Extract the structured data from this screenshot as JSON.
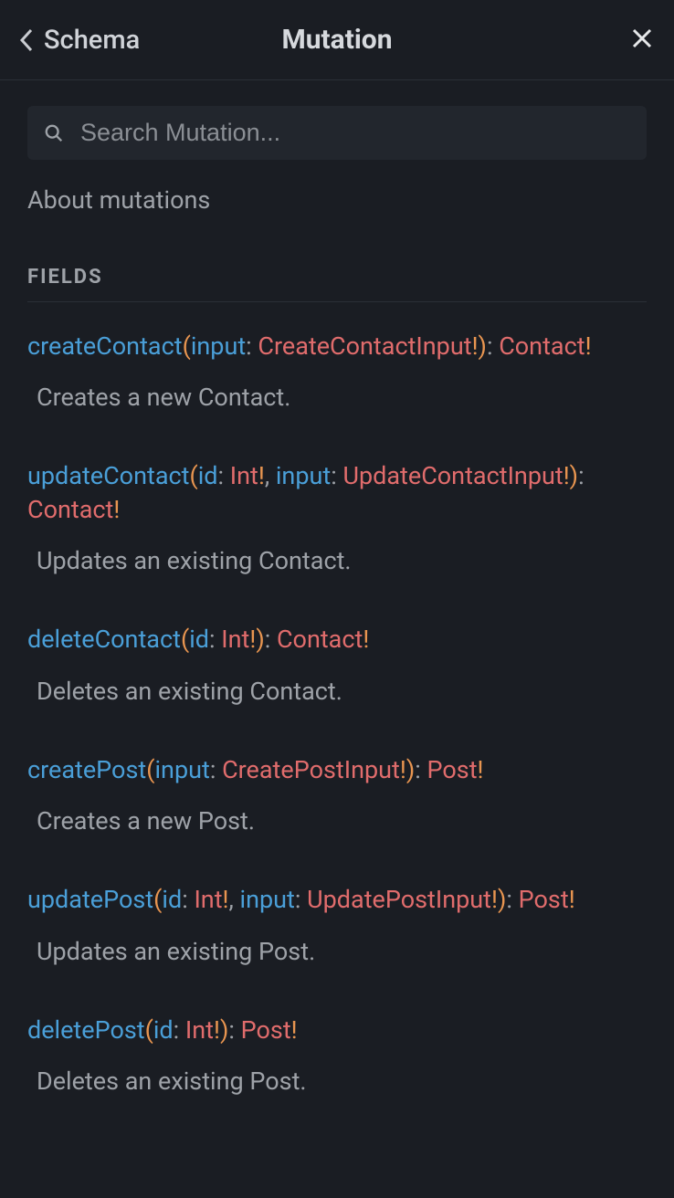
{
  "header": {
    "back_label": "Schema",
    "title": "Mutation"
  },
  "search": {
    "placeholder": "Search Mutation..."
  },
  "about_link": "About mutations",
  "section_heading": "FIELDS",
  "fields": [
    {
      "name": "createContact",
      "args": [
        {
          "name": "input",
          "type": "CreateContactInput",
          "required": true
        }
      ],
      "return_type": "Contact",
      "return_required": true,
      "description": "Creates a new Contact."
    },
    {
      "name": "updateContact",
      "args": [
        {
          "name": "id",
          "type": "Int",
          "required": true
        },
        {
          "name": "input",
          "type": "UpdateContactInput",
          "required": true
        }
      ],
      "return_type": "Contact",
      "return_required": true,
      "description": "Updates an existing Contact."
    },
    {
      "name": "deleteContact",
      "args": [
        {
          "name": "id",
          "type": "Int",
          "required": true
        }
      ],
      "return_type": "Contact",
      "return_required": true,
      "description": "Deletes an existing Contact."
    },
    {
      "name": "createPost",
      "args": [
        {
          "name": "input",
          "type": "CreatePostInput",
          "required": true
        }
      ],
      "return_type": "Post",
      "return_required": true,
      "description": "Creates a new Post."
    },
    {
      "name": "updatePost",
      "args": [
        {
          "name": "id",
          "type": "Int",
          "required": true
        },
        {
          "name": "input",
          "type": "UpdatePostInput",
          "required": true
        }
      ],
      "return_type": "Post",
      "return_required": true,
      "description": "Updates an existing Post."
    },
    {
      "name": "deletePost",
      "args": [
        {
          "name": "id",
          "type": "Int",
          "required": true
        }
      ],
      "return_type": "Post",
      "return_required": true,
      "description": "Deletes an existing Post."
    }
  ]
}
